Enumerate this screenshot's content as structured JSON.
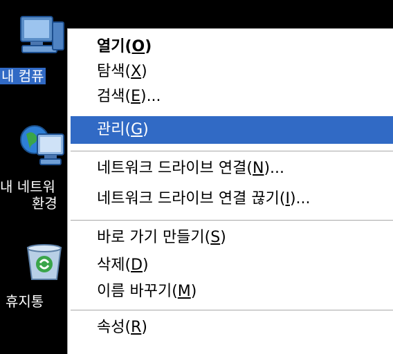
{
  "desktop": {
    "icons": [
      {
        "label": "내 컴퓨",
        "icon": "my-computer-icon"
      },
      {
        "label_line1": "내 네트워",
        "label_line2": "환경",
        "icon": "network-places-icon"
      },
      {
        "label": "휴지통",
        "icon": "recycle-bin-icon"
      }
    ]
  },
  "context_menu": {
    "items": [
      {
        "pre": "열기(",
        "key": "O",
        "post": ")"
      },
      {
        "pre": "탐색(",
        "key": "X",
        "post": ")"
      },
      {
        "pre": "검색(",
        "key": "E",
        "post": ")..."
      },
      {
        "pre": "관리(",
        "key": "G",
        "post": ")"
      },
      {
        "pre": "네트워크 드라이브 연결(",
        "key": "N",
        "post": ")..."
      },
      {
        "pre": "네트워크 드라이브 연결 끊기(",
        "key": "I",
        "post": ")..."
      },
      {
        "pre": "바로 가기 만들기(",
        "key": "S",
        "post": ")"
      },
      {
        "pre": "삭제(",
        "key": "D",
        "post": ")"
      },
      {
        "pre": "이름 바꾸기(",
        "key": "M",
        "post": ")"
      },
      {
        "pre": "속성(",
        "key": "R",
        "post": ")"
      }
    ],
    "highlight_color": "#316ac5"
  }
}
